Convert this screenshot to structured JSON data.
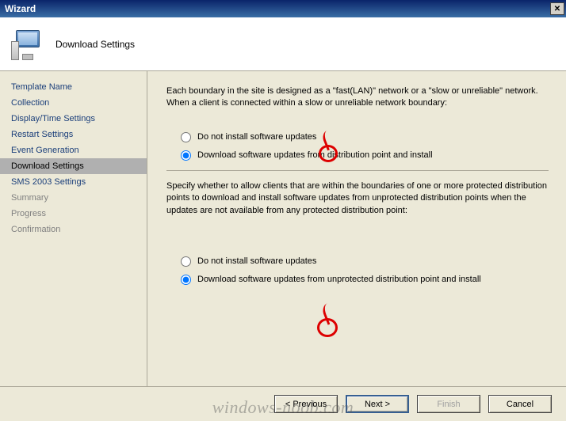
{
  "titlebar": {
    "title": "Wizard"
  },
  "header": {
    "title": "Download Settings"
  },
  "sidebar": {
    "items": [
      {
        "label": "Template Name",
        "state": "normal"
      },
      {
        "label": "Collection",
        "state": "normal"
      },
      {
        "label": "Display/Time Settings",
        "state": "normal"
      },
      {
        "label": "Restart Settings",
        "state": "normal"
      },
      {
        "label": "Event Generation",
        "state": "normal"
      },
      {
        "label": "Download Settings",
        "state": "selected"
      },
      {
        "label": "SMS 2003 Settings",
        "state": "normal"
      },
      {
        "label": "Summary",
        "state": "muted"
      },
      {
        "label": "Progress",
        "state": "muted"
      },
      {
        "label": "Confirmation",
        "state": "muted"
      }
    ]
  },
  "main": {
    "intro": "Each boundary in the site is designed as a \"fast(LAN)\" network or a \"slow or unreliable\" network. When a client is connected within a slow or unreliable network boundary:",
    "group1": {
      "option1": "Do not install software updates",
      "option2": "Download software updates from distribution point and install",
      "selected": "option2"
    },
    "desc": "Specify whether to allow clients that are within the boundaries of one or more protected distribution points to download and install software updates from unprotected distribution points when the updates are not available from any protected distribution point:",
    "group2": {
      "option1": "Do not install software updates",
      "option2": "Download software updates from unprotected distribution point and install",
      "selected": "option2"
    }
  },
  "buttons": {
    "previous": "< Previous",
    "next": "Next >",
    "finish": "Finish",
    "cancel": "Cancel"
  },
  "watermark": "windows-noob.com"
}
